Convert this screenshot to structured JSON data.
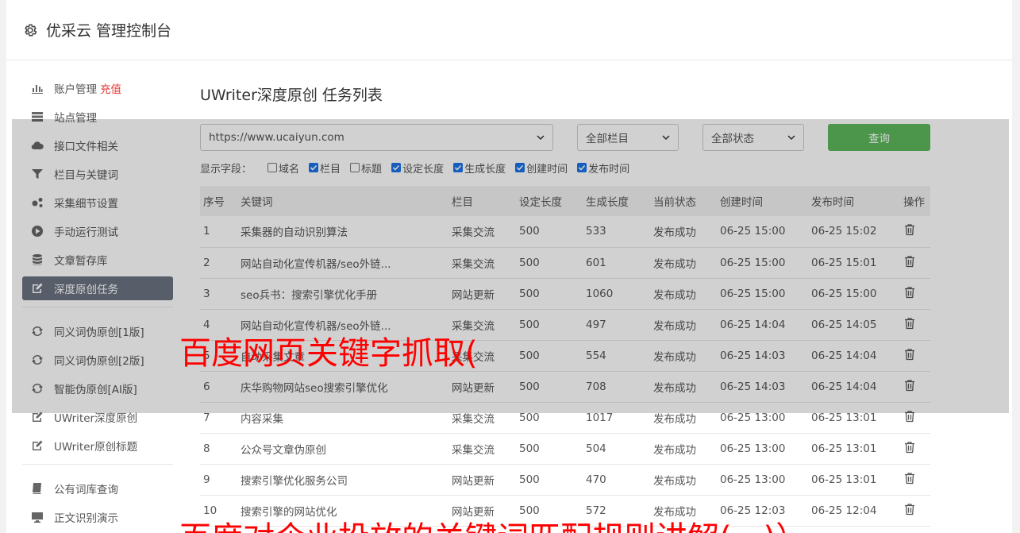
{
  "header": {
    "title": "优采云 管理控制台"
  },
  "sidebar": {
    "items": [
      {
        "label": "账户管理",
        "badge": "充值",
        "icon": "bar-chart-icon"
      },
      {
        "label": "站点管理",
        "icon": "server-icon"
      },
      {
        "label": "接口文件相关",
        "icon": "cloud-upload-icon"
      },
      {
        "label": "栏目与关键词",
        "icon": "filter-icon"
      },
      {
        "label": "采集细节设置",
        "icon": "gears-icon"
      },
      {
        "label": "手动运行测试",
        "icon": "play-icon"
      },
      {
        "label": "文章暂存库",
        "icon": "database-icon"
      },
      {
        "label": "深度原创任务",
        "icon": "edit-icon"
      }
    ],
    "items2": [
      {
        "label": "同义词伪原创[1版]",
        "icon": "refresh-icon"
      },
      {
        "label": "同义词伪原创[2版]",
        "icon": "refresh-icon"
      },
      {
        "label": "智能伪原创[AI版]",
        "icon": "refresh-icon"
      },
      {
        "label": "UWriter深度原创",
        "icon": "edit-icon"
      },
      {
        "label": "UWriter原创标题",
        "icon": "edit-icon"
      }
    ],
    "items3": [
      {
        "label": "公有词库查询",
        "icon": "book-icon"
      },
      {
        "label": "正文识别演示",
        "icon": "monitor-icon"
      }
    ]
  },
  "main": {
    "title": "UWriter深度原创 任务列表",
    "site_select": "https://www.ucaiyun.com",
    "column_select": "全部栏目",
    "status_select": "全部状态",
    "query_label": "查询",
    "fields_label": "显示字段：",
    "fields": [
      {
        "label": "域名",
        "checked": false
      },
      {
        "label": "栏目",
        "checked": true
      },
      {
        "label": "标题",
        "checked": false
      },
      {
        "label": "设定长度",
        "checked": true
      },
      {
        "label": "生成长度",
        "checked": true
      },
      {
        "label": "创建时间",
        "checked": true
      },
      {
        "label": "发布时间",
        "checked": true
      }
    ],
    "columns": [
      "序号",
      "关键词",
      "栏目",
      "设定长度",
      "生成长度",
      "当前状态",
      "创建时间",
      "发布时间",
      "操作"
    ],
    "rows": [
      [
        "1",
        "采集器的自动识别算法",
        "采集交流",
        "500",
        "533",
        "发布成功",
        "06-25 15:00",
        "06-25 15:02"
      ],
      [
        "2",
        "网站自动化宣传机器/seo外链...",
        "采集交流",
        "500",
        "601",
        "发布成功",
        "06-25 15:00",
        "06-25 15:01"
      ],
      [
        "3",
        "seo兵书：搜索引擎优化手册",
        "网站更新",
        "500",
        "1060",
        "发布成功",
        "06-25 15:00",
        "06-25 15:00"
      ],
      [
        "4",
        "网站自动化宣传机器/seo外链...",
        "采集交流",
        "500",
        "497",
        "发布成功",
        "06-25 14:04",
        "06-25 14:05"
      ],
      [
        "5",
        "自动采集文章",
        "采集交流",
        "500",
        "554",
        "发布成功",
        "06-25 14:03",
        "06-25 14:04"
      ],
      [
        "6",
        "庆华购物网站seo搜索引擎优化",
        "网站更新",
        "500",
        "708",
        "发布成功",
        "06-25 14:03",
        "06-25 14:04"
      ],
      [
        "7",
        "内容采集",
        "采集交流",
        "500",
        "1017",
        "发布成功",
        "06-25 13:00",
        "06-25 13:01"
      ],
      [
        "8",
        "公众号文章伪原创",
        "采集交流",
        "500",
        "504",
        "发布成功",
        "06-25 13:00",
        "06-25 13:01"
      ],
      [
        "9",
        "搜索引擎优化服务公司",
        "网站更新",
        "500",
        "470",
        "发布成功",
        "06-25 13:00",
        "06-25 13:01"
      ],
      [
        "10",
        "搜索引擎的网站优化",
        "网站更新",
        "500",
        "572",
        "发布成功",
        "06-25 12:03",
        "06-25 12:04"
      ]
    ]
  },
  "overlay_text": {
    "line1": "百度网页关键字抓取(",
    "line2": "百度对企业投放的关键词匹配规则讲解(一)）"
  },
  "colors": {
    "accent": "#5cb85c",
    "active_sidebar": "#6b7280",
    "success": "#2e8b2e",
    "badge": "#e53935",
    "overlay_text": "#ff0000"
  }
}
